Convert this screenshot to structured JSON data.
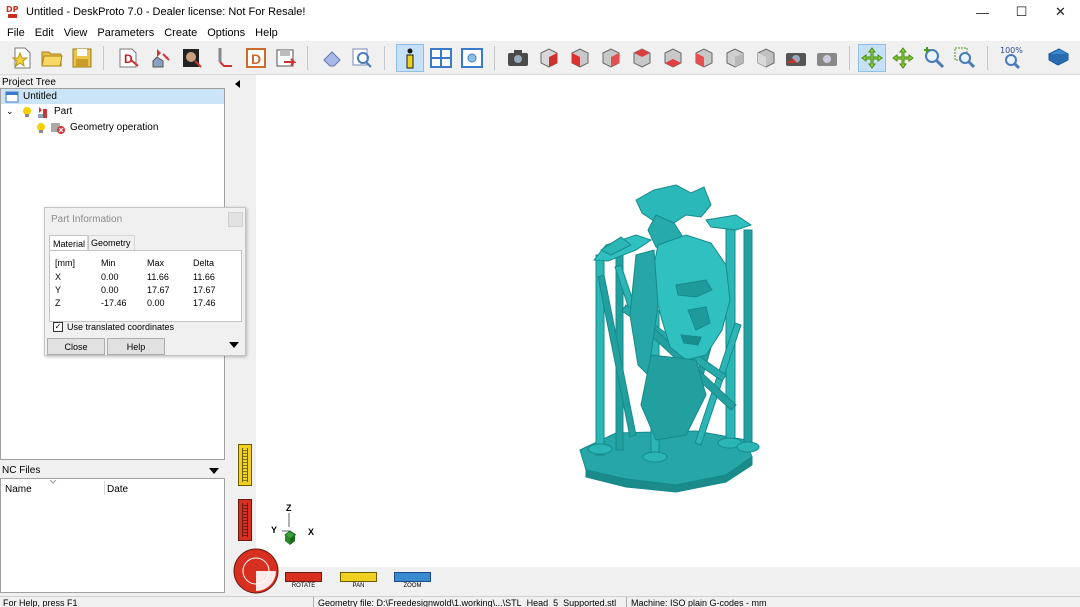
{
  "window": {
    "title": "Untitled - DeskProto 7.0 - Dealer license: Not For Resale!",
    "minimize": "—",
    "maximize": "☐",
    "close": "✕"
  },
  "menu": [
    "File",
    "Edit",
    "View",
    "Parameters",
    "Create",
    "Options",
    "Help"
  ],
  "toolbar": {
    "zoom_label": "100%",
    "active_tools": [
      "info",
      "pan"
    ]
  },
  "project_tree": {
    "header": "Project Tree",
    "root": "Untitled",
    "part": "Part",
    "operation": "Geometry operation"
  },
  "part_info": {
    "title": "Part Information",
    "tabs": [
      "Material",
      "Geometry"
    ],
    "columns": [
      "[mm]",
      "Min",
      "Max",
      "Delta"
    ],
    "rows": [
      {
        "axis": "X",
        "min": "0.00",
        "max": "11.66",
        "delta": "11.66"
      },
      {
        "axis": "Y",
        "min": "0.00",
        "max": "17.67",
        "delta": "17.67"
      },
      {
        "axis": "Z",
        "min": "-17.46",
        "max": "0.00",
        "delta": "17.46"
      }
    ],
    "checkbox_label": "Use translated coordinates",
    "checkbox_checked": true,
    "close_label": "Close",
    "help_label": "Help"
  },
  "nc_files": {
    "header": "NC Files",
    "columns": [
      "Name",
      "Date"
    ]
  },
  "viewport": {
    "axes": {
      "z": "Z",
      "y": "Y",
      "x": "X"
    },
    "modes": [
      "ROTATE",
      "PAN",
      "ZOOM"
    ],
    "model_color": "#2bb5b5"
  },
  "statusbar": {
    "help": "For Help, press F1",
    "geometry": "Geometry file: D:\\Freedesignwold\\1.working\\...\\STL_Head_5_Supported.stl",
    "machine": "Machine: ISO plain G-codes - mm"
  }
}
